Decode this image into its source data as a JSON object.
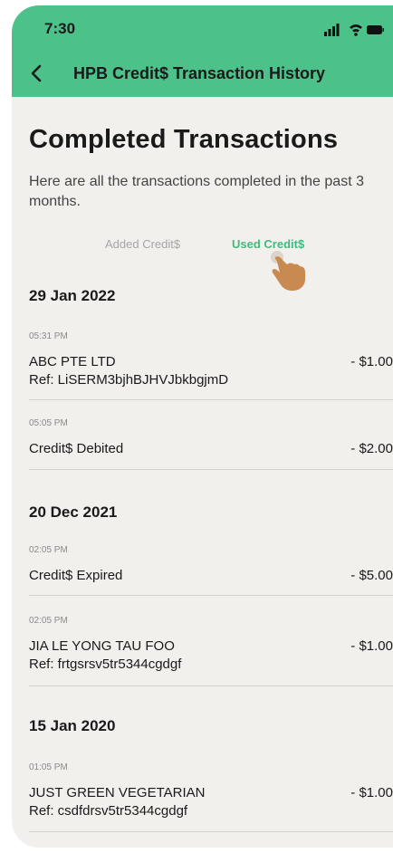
{
  "status_bar": {
    "time": "7:30"
  },
  "header": {
    "title": "HPB Credit$ Transaction History"
  },
  "main": {
    "title": "Completed Transactions",
    "subtitle": "Here are all the transactions completed in the past 3 months.",
    "tabs": [
      {
        "label": "Added Credit$",
        "active": false
      },
      {
        "label": "Used Credit$",
        "active": true
      }
    ],
    "groups": [
      {
        "date": "29 Jan 2022",
        "transactions": [
          {
            "time": "05:31 PM",
            "name": "ABC PTE LTD",
            "amount": "- $1.00",
            "ref": "Ref: LiSERM3bjhBJHVJbkbgjmD"
          },
          {
            "time": "05:05 PM",
            "name": "Credit$ Debited",
            "amount": "- $2.00"
          }
        ]
      },
      {
        "date": "20 Dec 2021",
        "transactions": [
          {
            "time": "02:05 PM",
            "name": "Credit$ Expired",
            "amount": "- $5.00"
          },
          {
            "time": "02:05 PM",
            "name": "JIA LE YONG TAU FOO",
            "amount": "- $1.00",
            "ref": "Ref: frtgsrsv5tr5344cgdgf"
          }
        ]
      },
      {
        "date": "15 Jan 2020",
        "transactions": [
          {
            "time": "01:05 PM",
            "name": "JUST GREEN VEGETARIAN",
            "amount": "- $1.00",
            "ref": "Ref: csdfdrsv5tr5344cgdgf"
          }
        ]
      }
    ]
  },
  "colors": {
    "accent": "#4dc18a",
    "active_tab": "#41b980",
    "background": "#f2f0ec"
  }
}
